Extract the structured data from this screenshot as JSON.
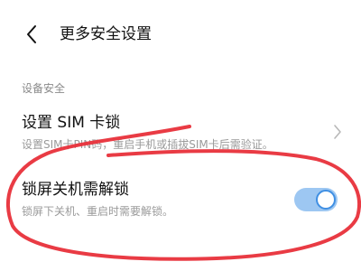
{
  "header": {
    "back_icon": "chevron-left-icon",
    "title": "更多安全设置"
  },
  "section": {
    "label": "设备安全"
  },
  "settings": [
    {
      "title": "设置 SIM 卡锁",
      "subtitle": "设置SIM卡PIN码，重启手机或插拔SIM卡后需验证。",
      "control": "chevron-right-icon"
    },
    {
      "title": "锁屏关机需解锁",
      "subtitle": "锁屏下关机、重启时需要解锁。",
      "control": "toggle",
      "toggle_on": true
    }
  ],
  "colors": {
    "annotation": "#e8303a",
    "toggle_track": "#9dc7f2",
    "toggle_accent": "#3f8fe3"
  }
}
